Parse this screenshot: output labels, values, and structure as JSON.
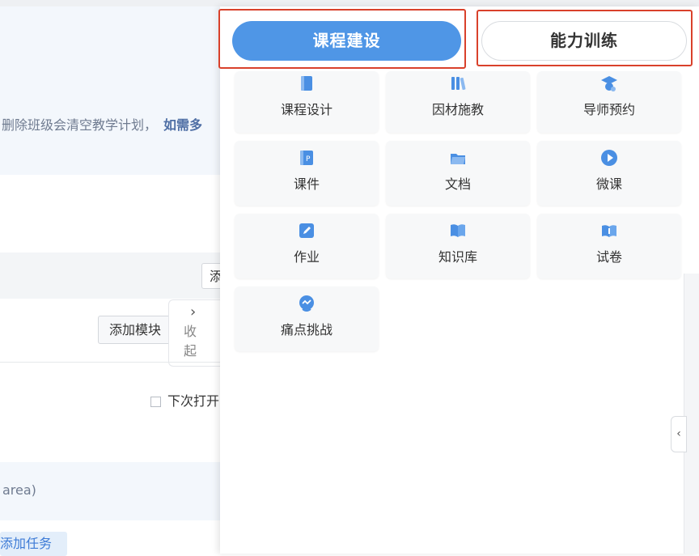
{
  "background": {
    "notice_text": "删除班级会清空教学计划，",
    "notice_emphasis": "如需多",
    "truncated_button": "添",
    "add_module_button": "添加模块",
    "collapse_chevron": "›",
    "collapse_label": "收起",
    "checkbox_label": "下次打开",
    "area_text": " area)",
    "add_task_button": "添加任务"
  },
  "drawer": {
    "tabs": [
      {
        "label": "课程建设",
        "active": true
      },
      {
        "label": "能力训练",
        "active": false
      }
    ],
    "tiles": [
      {
        "label": "课程设计",
        "icon": "book-icon"
      },
      {
        "label": "因材施教",
        "icon": "books-stack-icon"
      },
      {
        "label": "导师预约",
        "icon": "mentor-cap-icon"
      },
      {
        "label": "课件",
        "icon": "presentation-file-icon"
      },
      {
        "label": "文档",
        "icon": "folder-icon"
      },
      {
        "label": "微课",
        "icon": "play-icon"
      },
      {
        "label": "作业",
        "icon": "edit-pencil-icon"
      },
      {
        "label": "知识库",
        "icon": "open-book-icon"
      },
      {
        "label": "试卷",
        "icon": "exam-book-icon"
      },
      {
        "label": "痛点挑战",
        "icon": "challenge-badge-icon"
      }
    ],
    "side_handle": "‹"
  },
  "colors": {
    "accent": "#4f96e6",
    "highlight": "#d9412b",
    "icon": "#4a8fe3"
  }
}
